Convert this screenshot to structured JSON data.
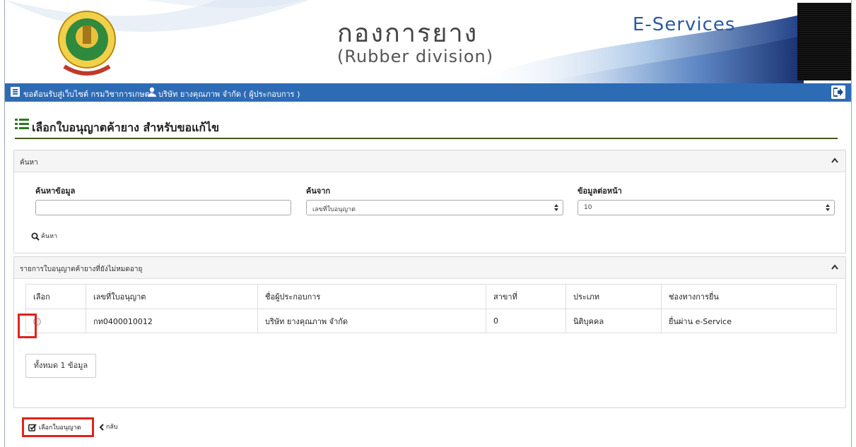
{
  "header": {
    "title_thai": "กองการยาง",
    "title_english": "(Rubber division)",
    "service_label": "E-Services",
    "logo_text": "กรมวิชาการเกษตร"
  },
  "navbar": {
    "welcome_text": "ขอต้อนรับสู่เว็บไซต์ กรมวิชาการเกษตร",
    "company_text": "บริษัท ยางคุณภาพ จำกัด ( ผู้ประกอบการ )"
  },
  "page": {
    "title": "เลือกใบอนุญาตค้ายาง สำหรับขอแก้ไข"
  },
  "search_panel": {
    "title": "ค้นหา",
    "keyword_label": "ค้นหาข้อมูล",
    "keyword_value": "",
    "search_from_label": "ค้นจาก",
    "search_from_selected": "เลขที่ใบอนุญาต",
    "page_size_label": "ข้อมูลต่อหน้า",
    "page_size_selected": "10",
    "search_button_label": "ค้นหา"
  },
  "results_panel": {
    "title": "รายการใบอนุญาตค้ายางที่ยังไม่หมดอายุ",
    "columns": [
      "เลือก",
      "เลขที่ใบอนุญาต",
      "ชื่อผู้ประกอบการ",
      "สาขาที่",
      "ประเภท",
      "ช่องทางการยื่น"
    ],
    "rows": [
      {
        "license_no": "กท0400010012",
        "operator_name": "บริษัท ยางคุณภาพ จำกัด",
        "branch": "0",
        "type": "นิติบุคคล",
        "channel": "ยื่นผ่าน e-Service"
      }
    ],
    "total_text": "ทั้งหมด 1 ข้อมูล"
  },
  "actions": {
    "select_label": "เลือกใบอนุญาต",
    "back_label": "กลับ"
  },
  "colors": {
    "navbar": "#2e6bb5",
    "heading_rule": "#445b1e",
    "highlight": "#e2231a",
    "eservices": "#2c5aa0"
  }
}
